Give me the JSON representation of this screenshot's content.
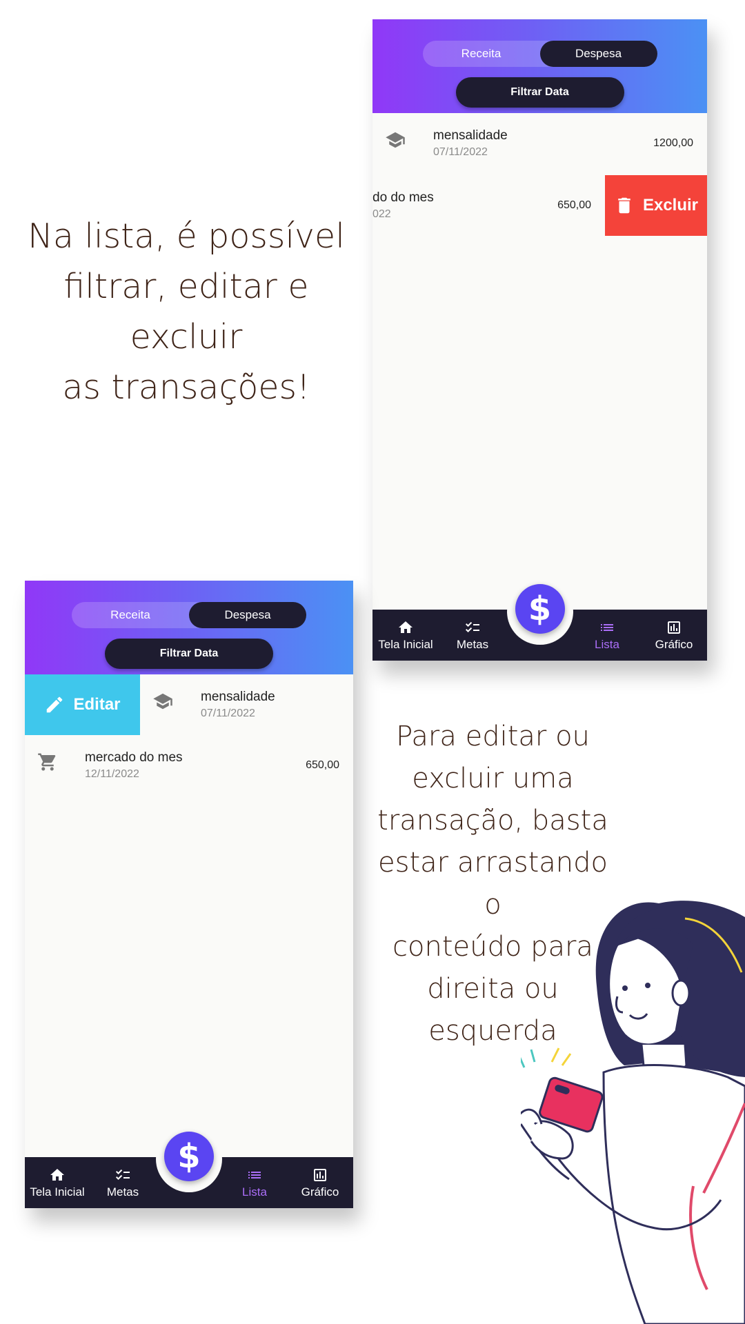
{
  "captions": {
    "top": [
      "Na lista, é possível",
      "filtrar, editar e excluir",
      "as transações!"
    ],
    "right": [
      "Para editar ou",
      "excluir uma",
      "transação, basta",
      "estar arrastando o",
      "conteúdo para",
      "direita ou",
      "esquerda"
    ]
  },
  "header": {
    "toggle": {
      "income_label": "Receita",
      "expense_label": "Despesa",
      "selected": "Despesa"
    },
    "filter_label": "Filtrar Data"
  },
  "swipe_actions": {
    "delete_label": "Excluir",
    "edit_label": "Editar"
  },
  "screen_top": {
    "transactions": [
      {
        "title": "mensalidade",
        "date": "07/11/2022",
        "amount": "1200,00",
        "icon": "school-icon"
      },
      {
        "title": "do do mes",
        "date": "022",
        "amount": "650,00",
        "icon": "cart-icon"
      }
    ]
  },
  "screen_bottom": {
    "transactions": [
      {
        "title": "mensalidade",
        "date": "07/11/2022",
        "icon": "school-icon"
      },
      {
        "title": "mercado do mes",
        "date": "12/11/2022",
        "amount": "650,00",
        "icon": "cart-icon"
      }
    ]
  },
  "nav": {
    "items": [
      {
        "label": "Tela Inicial",
        "icon": "home-icon"
      },
      {
        "label": "Metas",
        "icon": "checklist-icon"
      },
      {
        "label": "Lista",
        "icon": "list-icon",
        "active": true
      },
      {
        "label": "Gráfico",
        "icon": "chart-icon"
      }
    ],
    "fab_symbol": "$"
  },
  "colors": {
    "header_gradient_start": "#9038f7",
    "header_gradient_end": "#4b91f4",
    "dark": "#1e1c30",
    "fab": "#5a45f2",
    "delete": "#f4433a",
    "edit": "#3fc7ec",
    "active_nav": "#ab6ef8",
    "caption_text": "#3f2418"
  }
}
